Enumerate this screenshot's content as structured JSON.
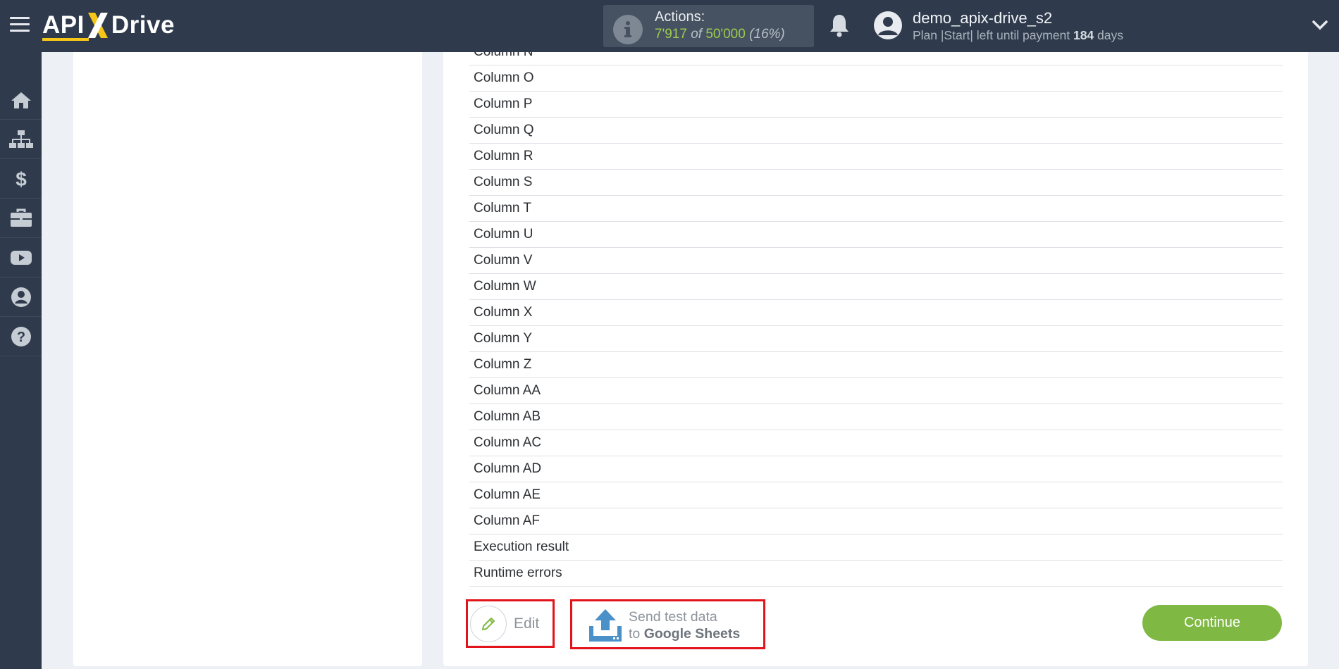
{
  "brand": {
    "logo_left": "API",
    "logo_right": "Drive"
  },
  "header": {
    "actions_title": "Actions:",
    "actions_used": "7'917",
    "actions_of": "of",
    "actions_total": "50'000",
    "actions_pct": "(16%)",
    "user_name": "demo_apix-drive_s2",
    "plan_prefix": "Plan |Start| left until payment",
    "plan_days": "184",
    "plan_suffix": "days"
  },
  "sidebar": {
    "items": [
      {
        "icon": "home-icon"
      },
      {
        "icon": "sitemap-icon"
      },
      {
        "icon": "dollar-icon"
      },
      {
        "icon": "briefcase-icon"
      },
      {
        "icon": "youtube-icon"
      },
      {
        "icon": "user-icon"
      },
      {
        "icon": "help-icon"
      }
    ]
  },
  "fields": {
    "rows": [
      "Column N",
      "Column O",
      "Column P",
      "Column Q",
      "Column R",
      "Column S",
      "Column T",
      "Column U",
      "Column V",
      "Column W",
      "Column X",
      "Column Y",
      "Column Z",
      "Column AA",
      "Column AB",
      "Column AC",
      "Column AD",
      "Column AE",
      "Column AF",
      "Execution result",
      "Runtime errors"
    ]
  },
  "buttons": {
    "edit_label": "Edit",
    "send_line1": "Send test data",
    "send_line2_prefix": "to",
    "send_line2_target": "Google Sheets",
    "continue_label": "Continue"
  },
  "colors": {
    "topbar": "#2f3b4c",
    "accent_green": "#7fb843",
    "highlight_red": "#e3131b",
    "logo_x": "#f5c518"
  }
}
